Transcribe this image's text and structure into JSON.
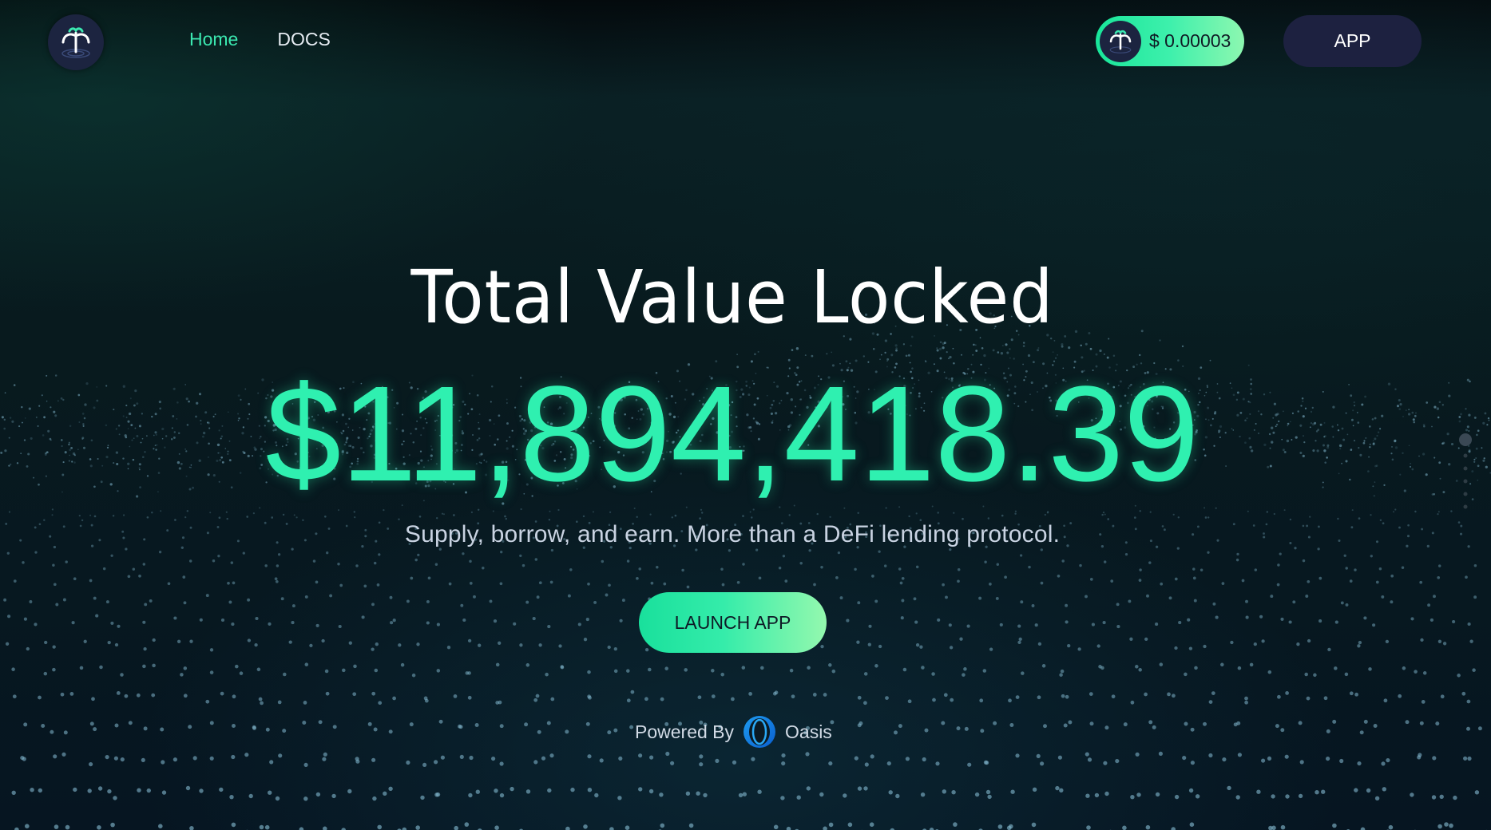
{
  "nav": {
    "home_label": "Home",
    "docs_label": "DOCS"
  },
  "header": {
    "token_price": "$ 0.00003",
    "app_button_label": "APP",
    "logo_icon": "fountain-icon",
    "token_icon": "fountain-icon"
  },
  "hero": {
    "title": "Total Value Locked",
    "tvl_value": "$11,894,418.39",
    "subtitle": "Supply, borrow, and earn. More than a DeFi lending protocol.",
    "launch_label": "LAUNCH APP"
  },
  "footer": {
    "powered_by_label": "Powered By",
    "partner_name": "Oasis",
    "partner_icon": "oasis-icon"
  },
  "colors": {
    "accent": "#2ff0b0",
    "nav_active": "#3be8b0",
    "button_dark": "#1d2140",
    "background": "#06141a"
  }
}
